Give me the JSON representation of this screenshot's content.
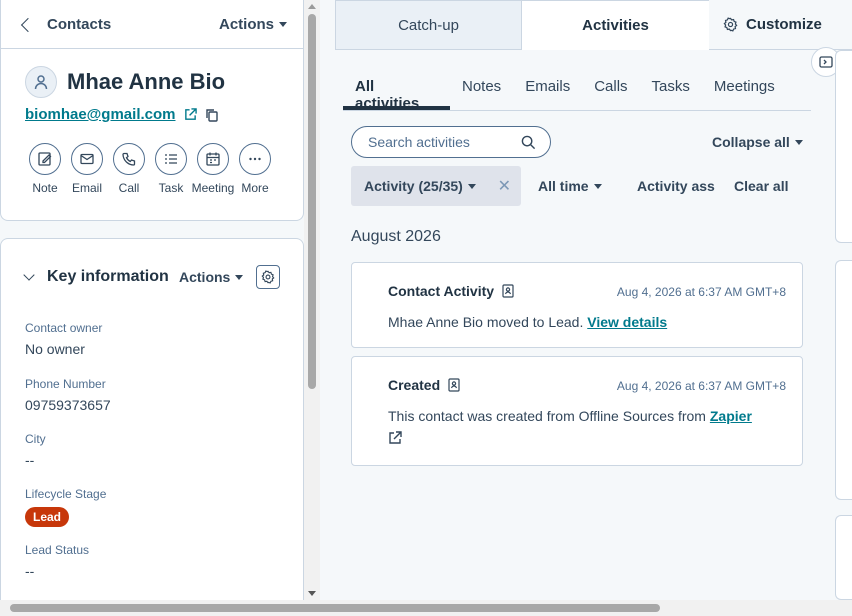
{
  "header": {
    "back_label": "Contacts",
    "actions_label": "Actions"
  },
  "contact": {
    "name": "Mhae Anne Bio",
    "email": "biomhae@gmail.com"
  },
  "quick_actions": [
    {
      "label": "Note",
      "icon": "note-icon"
    },
    {
      "label": "Email",
      "icon": "email-icon"
    },
    {
      "label": "Call",
      "icon": "call-icon"
    },
    {
      "label": "Task",
      "icon": "task-icon"
    },
    {
      "label": "Meeting",
      "icon": "meeting-icon"
    },
    {
      "label": "More",
      "icon": "more-icon"
    }
  ],
  "key_info": {
    "title": "Key information",
    "actions_label": "Actions",
    "fields": [
      {
        "label": "Contact owner",
        "value": "No owner"
      },
      {
        "label": "Phone Number",
        "value": "09759373657"
      },
      {
        "label": "City",
        "value": "--"
      },
      {
        "label": "Lifecycle Stage",
        "value": "Lead"
      },
      {
        "label": "Lead Status",
        "value": "--"
      }
    ]
  },
  "top_tabs": [
    {
      "label": "Catch-up"
    },
    {
      "label": "Activities"
    },
    {
      "label": "Customize"
    }
  ],
  "sub_tabs": [
    {
      "label": "All activities"
    },
    {
      "label": "Notes"
    },
    {
      "label": "Emails"
    },
    {
      "label": "Calls"
    },
    {
      "label": "Tasks"
    },
    {
      "label": "Meetings"
    }
  ],
  "filters": {
    "search_placeholder": "Search activities",
    "collapse_all": "Collapse all",
    "activity_chip": "Activity (25/35)",
    "all_time": "All time",
    "activity_assigned": "Activity assigned to",
    "clear_all": "Clear all"
  },
  "month_heading": "August 2026",
  "activities": [
    {
      "title": "Contact Activity",
      "date": "Aug 4, 2026 at 6:37 AM GMT+8",
      "text": "Mhae Anne Bio moved to Lead.",
      "link": "View details"
    },
    {
      "title": "Created",
      "date": "Aug 4, 2026 at 6:37 AM GMT+8",
      "text": "This contact was created from Offline Sources from",
      "link": "Zapier"
    }
  ],
  "colors": {
    "accent_link": "#007a8c",
    "lead_badge": "#c7370a",
    "text": "#33475b"
  }
}
